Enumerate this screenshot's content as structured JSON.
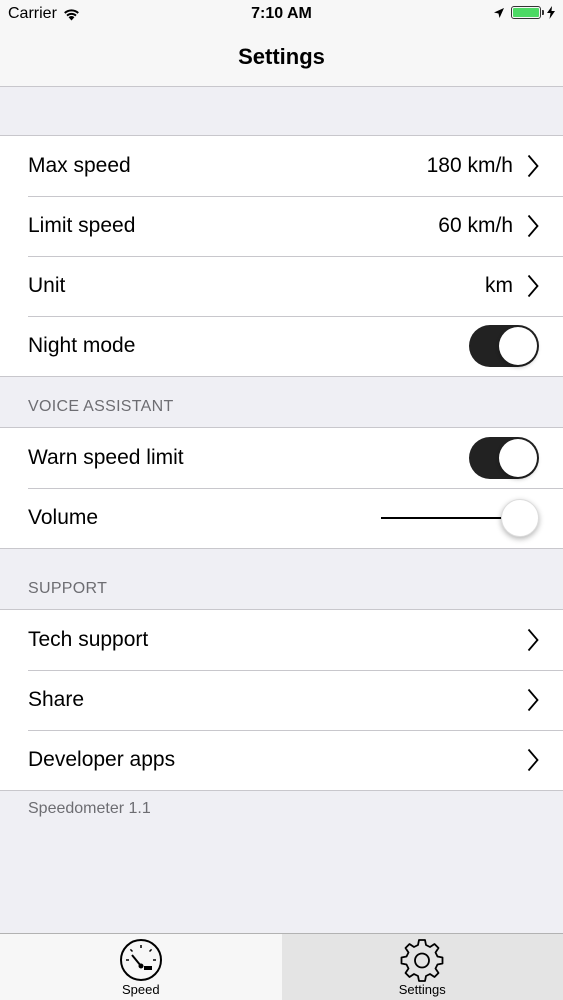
{
  "status_bar": {
    "carrier": "Carrier",
    "time": "7:10 AM",
    "battery_color": "#4cd964"
  },
  "nav": {
    "title": "Settings"
  },
  "general": {
    "max_speed": {
      "label": "Max speed",
      "value": "180 km/h"
    },
    "limit_speed": {
      "label": "Limit speed",
      "value": "60 km/h"
    },
    "unit": {
      "label": "Unit",
      "value": "km"
    },
    "night_mode": {
      "label": "Night mode",
      "on": true
    }
  },
  "voice_assistant": {
    "header": "VOICE ASSISTANT",
    "warn_speed_limit": {
      "label": "Warn speed limit",
      "on": true
    },
    "volume": {
      "label": "Volume",
      "level": 1.0
    }
  },
  "support": {
    "header": "SUPPORT",
    "items": [
      {
        "label": "Tech support"
      },
      {
        "label": "Share"
      },
      {
        "label": "Developer apps"
      }
    ]
  },
  "footer": {
    "version": "Speedometer 1.1"
  },
  "tab_bar": {
    "tabs": [
      {
        "label": "Speed",
        "icon": "speedometer-icon",
        "selected": false
      },
      {
        "label": "Settings",
        "icon": "gear-icon",
        "selected": true
      }
    ]
  }
}
